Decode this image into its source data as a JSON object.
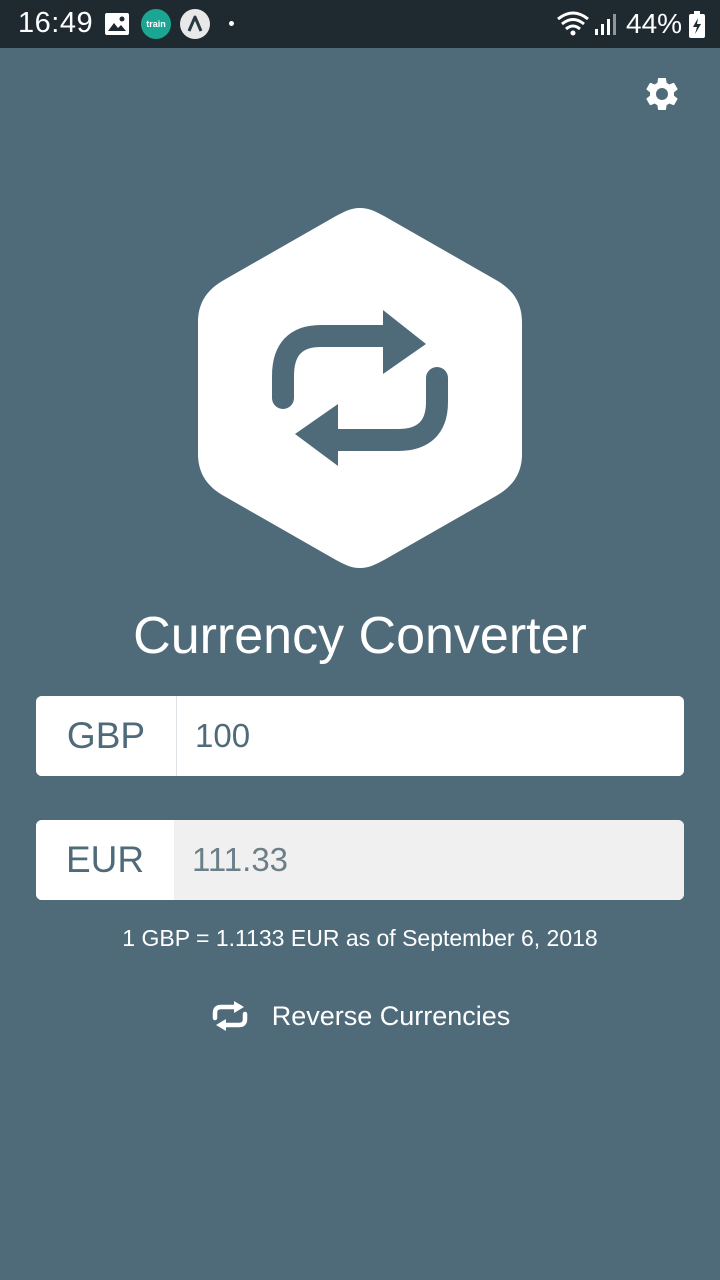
{
  "status_bar": {
    "time": "16:49",
    "notification_icons": [
      "gallery-icon",
      "train-app-icon",
      "a-app-icon",
      "dot-icon"
    ],
    "train_label": "train",
    "a_label": "A",
    "battery_percent": "44%",
    "right_icons": [
      "wifi-icon",
      "signal-icon",
      "battery-charging-icon"
    ]
  },
  "toolbar": {
    "settings_icon": "gear-icon"
  },
  "logo": {
    "icon": "swap-arrows-hexagon-icon",
    "colors": {
      "background": "#4f6b7a",
      "hexagon": "#ffffff",
      "arrows": "#4f6b7a"
    }
  },
  "app_title": "Currency Converter",
  "converter": {
    "from": {
      "currency": "GBP",
      "amount": "100"
    },
    "to": {
      "currency": "EUR",
      "amount": "111.33"
    },
    "rate_text": "1 GBP = 1.1133 EUR as of September 6, 2018"
  },
  "reverse": {
    "icon": "swap-icon",
    "label": "Reverse Currencies"
  }
}
